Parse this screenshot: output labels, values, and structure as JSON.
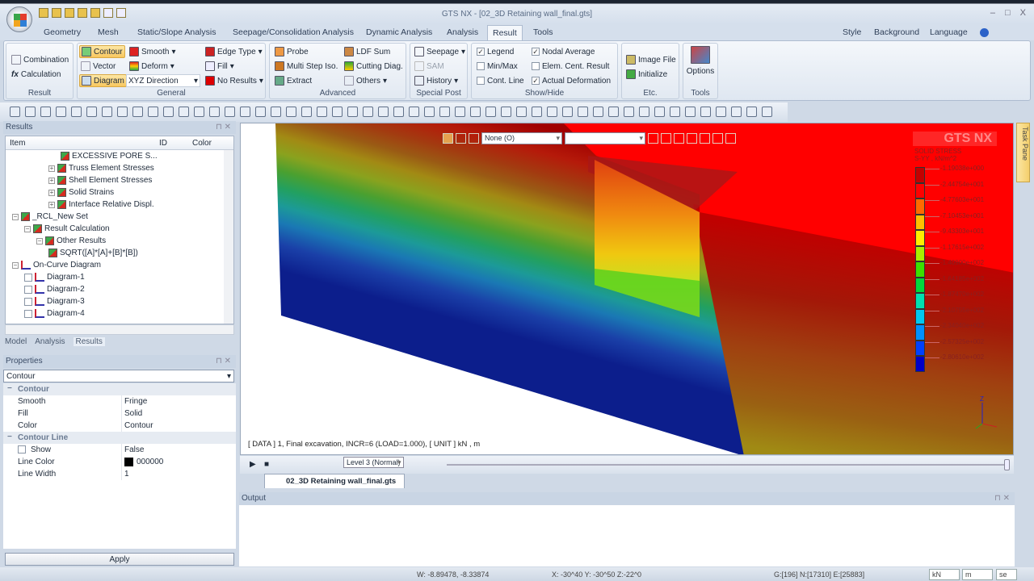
{
  "window": {
    "title": "GTS NX - [02_3D Retaining wall_final.gts]",
    "minimize": "–",
    "maximize": "□",
    "close": "X"
  },
  "menu": {
    "tabs": [
      "Geometry",
      "Mesh",
      "Static/Slope Analysis",
      "Seepage/Consolidation Analysis",
      "Dynamic Analysis",
      "Analysis",
      "Result",
      "Tools"
    ],
    "active": "Result",
    "right": [
      "Style",
      "Background",
      "Language"
    ]
  },
  "ribbon": {
    "result": {
      "label": "Result",
      "items": [
        "Combination",
        "Calculation"
      ]
    },
    "general": {
      "label": "General",
      "contour": "Contour",
      "vector": "Vector",
      "diagram": "Diagram",
      "smooth": "Smooth",
      "deform": "Deform",
      "direction": "XYZ Direction",
      "edge_type": "Edge Type",
      "fill": "Fill",
      "no_results": "No Results"
    },
    "advanced": {
      "label": "Advanced",
      "probe": "Probe",
      "multi_step": "Multi Step Iso.",
      "extract": "Extract",
      "ldf_sum": "LDF Sum",
      "cutting": "Cutting Diag.",
      "others": "Others"
    },
    "special_post": {
      "label": "Special Post",
      "seepage": "Seepage",
      "sam": "SAM",
      "history": "History"
    },
    "show_hide": {
      "label": "Show/Hide",
      "legend": {
        "label": "Legend",
        "checked": true
      },
      "minmax": {
        "label": "Min/Max",
        "checked": false
      },
      "cont_line": {
        "label": "Cont. Line",
        "checked": false
      },
      "nodal_avg": {
        "label": "Nodal Average",
        "checked": true
      },
      "elem_cent": {
        "label": "Elem. Cent. Result",
        "checked": false
      },
      "actual_def": {
        "label": "Actual Deformation",
        "checked": true
      }
    },
    "etc": {
      "label": "Etc.",
      "image_file": "Image File",
      "initialize": "Initialize"
    },
    "tools": {
      "label": "Tools",
      "options": "Options"
    }
  },
  "results_panel": {
    "title": "Results",
    "columns": [
      "Item",
      "ID",
      "Color"
    ],
    "tree": [
      {
        "label": "EXCESSIVE PORE S...",
        "level": 4,
        "expander": ""
      },
      {
        "label": "Truss Element Stresses",
        "level": 3,
        "expander": "+"
      },
      {
        "label": "Shell Element Stresses",
        "level": 3,
        "expander": "+"
      },
      {
        "label": "Solid Strains",
        "level": 3,
        "expander": "+"
      },
      {
        "label": "Interface Relative Displ.",
        "level": 3,
        "expander": "+"
      },
      {
        "label": "_RCL_New Set",
        "level": 0,
        "expander": "-"
      },
      {
        "label": "Result Calculation",
        "level": 1,
        "expander": "-"
      },
      {
        "label": "Other Results",
        "level": 2,
        "expander": "-"
      },
      {
        "label": "SQRT([A]*[A]+[B]*[B])",
        "level": 3,
        "expander": ""
      },
      {
        "label": "On-Curve Diagram",
        "level": 0,
        "expander": "-",
        "type": "diagram"
      },
      {
        "label": "Diagram-1",
        "level": 1,
        "type": "diagram-check"
      },
      {
        "label": "Diagram-2",
        "level": 1,
        "type": "diagram-check"
      },
      {
        "label": "Diagram-3",
        "level": 1,
        "type": "diagram-check"
      },
      {
        "label": "Diagram-4",
        "level": 1,
        "type": "diagram-check"
      }
    ],
    "tabs": [
      "Model",
      "Analysis",
      "Results"
    ],
    "active_tab": "Results"
  },
  "properties": {
    "title": "Properties",
    "selected": "Contour",
    "rows": [
      {
        "key": "Contour",
        "cat": true
      },
      {
        "key": "Smooth",
        "value": "Fringe"
      },
      {
        "key": "Fill",
        "value": "Solid"
      },
      {
        "key": "Color",
        "value": "Contour"
      },
      {
        "key": "Contour Line",
        "cat": true
      },
      {
        "key": "Show",
        "value": "False",
        "checkbox": true
      },
      {
        "key": "Line Color",
        "value": "000000",
        "swatch": "#000000"
      },
      {
        "key": "Line Width",
        "value": "1"
      }
    ],
    "apply": "Apply"
  },
  "viewport": {
    "toolbar": {
      "select1": "None (O)",
      "select2": ""
    },
    "legend": {
      "logo": "GTS NX",
      "title": "SOLID STRESS",
      "subtitle": "S-YY , kN/m^2",
      "values": [
        "-1.19038e+000",
        "-2.44754e+001",
        "-4.77603e+001",
        "-7.10453e+001",
        "-9.43303e+001",
        "-1.17615e+002",
        "-1.40900e+002",
        "-1.64185e+002",
        "-1.87470e+002",
        "-2.10755e+002",
        "-2.34040e+002",
        "-2.57325e+002",
        "-2.80610e+002"
      ],
      "colors": [
        "#c40000",
        "#ff0000",
        "#ff6a00",
        "#ffc000",
        "#ffee00",
        "#a8f000",
        "#3ce000",
        "#00d83c",
        "#00e0b0",
        "#00c8f0",
        "#0090ff",
        "#0040ff",
        "#0000c8"
      ]
    },
    "info": "[ DATA ]  1, Final excavation, INCR=6 (LOAD=1.000),   [ UNIT ]   kN ,  m",
    "axis": {
      "z": "Z",
      "y": "Y",
      "x": "X"
    }
  },
  "animation": {
    "level": "Level 3 (Normal)"
  },
  "file_tab": "02_3D Retaining wall_final.gts",
  "output": {
    "title": "Output"
  },
  "task_pane": "Task Pane",
  "status": {
    "w": "W: -8.89478, -8.33874",
    "xyz": "X: -30^40 Y: -30^50 Z:-22^0",
    "counts": "G:[196] N:[17310] E:[25883]",
    "unit_force": "kN",
    "unit_length": "m",
    "unit_time": "se"
  }
}
